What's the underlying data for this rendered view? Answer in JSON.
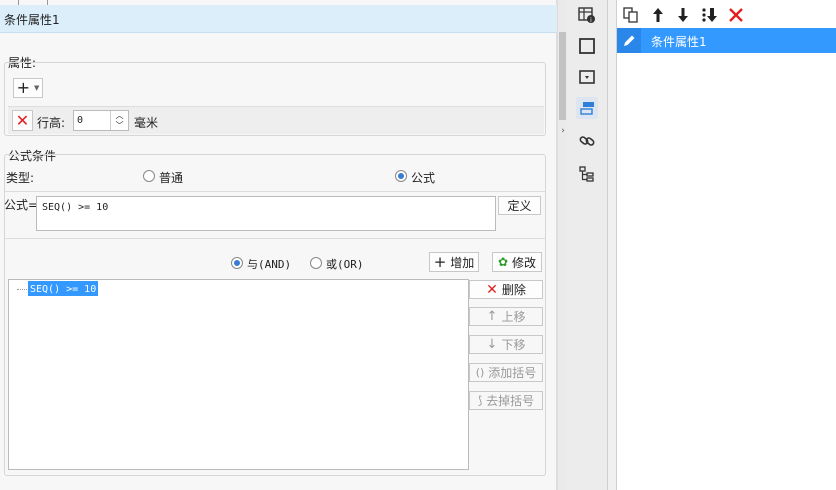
{
  "title": "条件属性1",
  "properties": {
    "section_label": "属性:",
    "row_height_label": "行高:",
    "row_height_value": "0",
    "unit": "毫米"
  },
  "formula": {
    "section_label": "公式条件",
    "type_label": "类型:",
    "type_options": [
      "普通",
      "公式"
    ],
    "selected_type": "公式",
    "formula_label": "公式=",
    "formula_value": "SEQ() >= 10",
    "define_button": "定义",
    "logic_and": "与(AND)",
    "logic_or": "或(OR)",
    "selected_logic": "与(AND)",
    "add_button": "增加",
    "modify_button": "修改",
    "condition_items": [
      "SEQ() >= 10"
    ],
    "side_buttons": {
      "delete": "删除",
      "move_up": "上移",
      "move_down": "下移",
      "add_bracket": "添加括号",
      "remove_bracket": "去掉括号"
    }
  },
  "right_panel": {
    "list_items": [
      "条件属性1"
    ]
  },
  "colors": {
    "title_bar": "#dbeefa",
    "selection": "#3399ff",
    "delete_red": "#e02020"
  }
}
